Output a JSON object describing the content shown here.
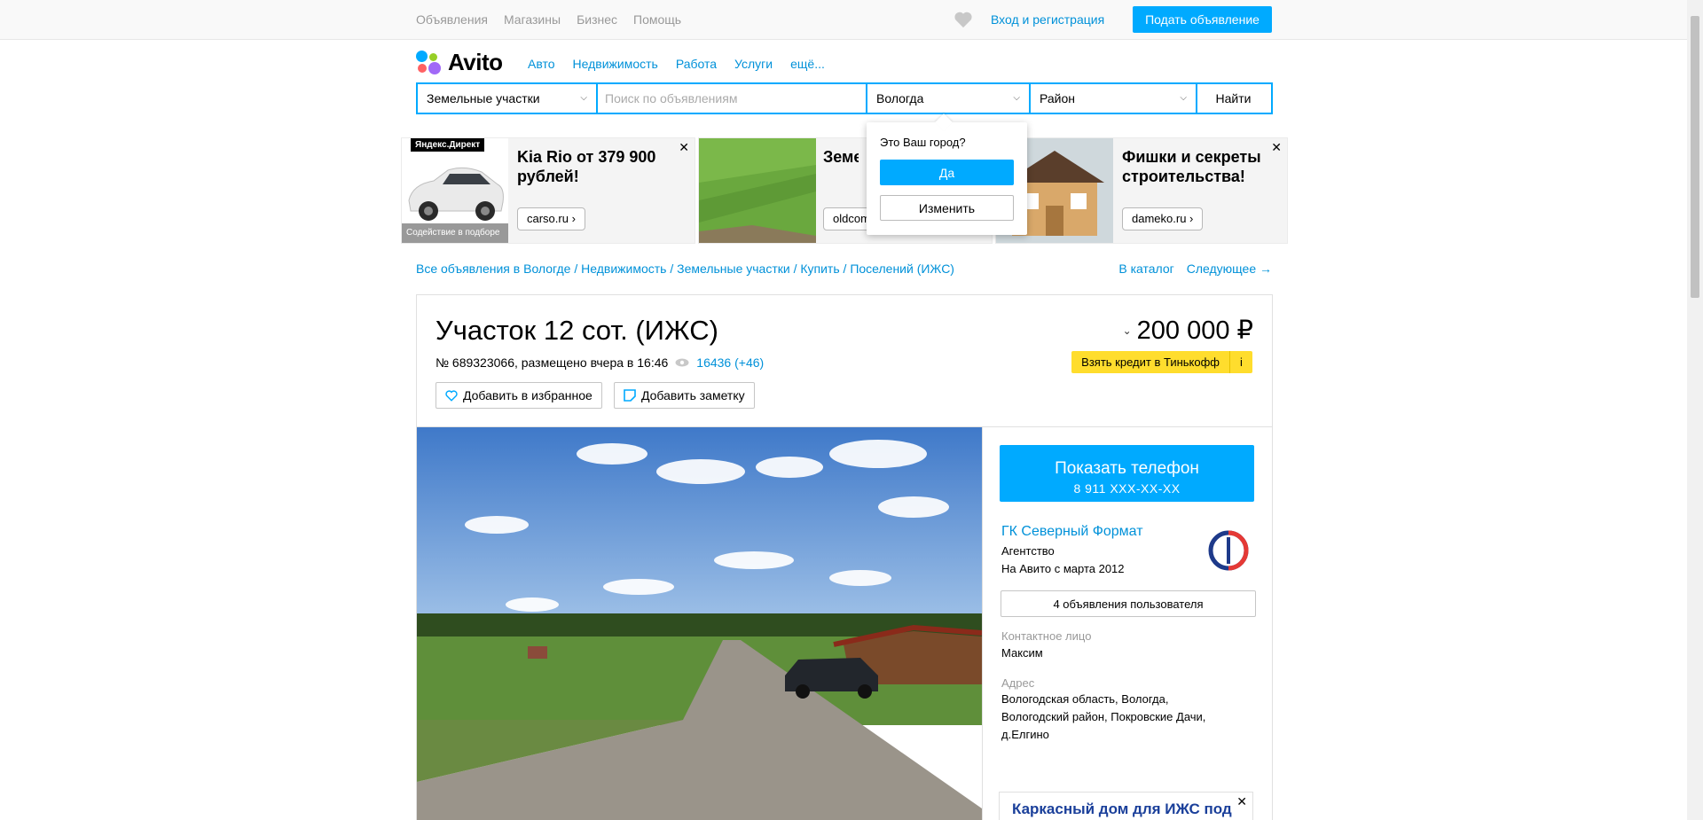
{
  "topbar": {
    "nav": [
      "Объявления",
      "Магазины",
      "Бизнес",
      "Помощь"
    ],
    "login": "Вход и регистрация",
    "post_button": "Подать объявление"
  },
  "logo": {
    "text": "Avito"
  },
  "mainnav": [
    "Авто",
    "Недвижимость",
    "Работа",
    "Услуги",
    "ещё..."
  ],
  "search": {
    "category": "Земельные участки",
    "placeholder": "Поиск по объявлениям",
    "city": "Вологда",
    "district": "Район",
    "find_button": "Найти"
  },
  "city_popup": {
    "question": "Это Ваш город?",
    "yes": "Да",
    "change": "Изменить"
  },
  "ads": [
    {
      "badge": "Яндекс.Директ",
      "title": "Kia Rio от 379 900 рублей!",
      "link": "carso.ru ›",
      "strip": "Содействие в подборе"
    },
    {
      "title": "Земельные участки",
      "link": "oldcom"
    },
    {
      "title": "Фишки и секреты строительства!",
      "link": "dameko.ru ›"
    }
  ],
  "breadcrumbs": [
    "Все объявления в Вологде",
    "Недвижимость",
    "Земельные участки",
    "Купить",
    "Поселений (ИЖС)"
  ],
  "catalog_links": {
    "catalog": "В каталог",
    "next": "Следующее →"
  },
  "listing": {
    "title": "Участок 12 сот. (ИЖС)",
    "meta": "№ 689323066, размещено вчера в 16:46",
    "views": "16436 (+46)",
    "favorite_button": "Добавить в избранное",
    "note_button": "Добавить заметку",
    "price": "200 000 ₽",
    "credit_button": "Взять кредит в Тинькофф",
    "credit_info": "i"
  },
  "seller": {
    "phone_button": "Показать телефон",
    "phone_masked": "8 911 XXX-XX-XX",
    "name": "ГК Северный Формат",
    "type": "Агентство",
    "since": "На Авито с марта 2012",
    "ads_button": "4 объявления пользователя",
    "contact_label": "Контактное лицо",
    "contact_name": "Максим",
    "address_label": "Адрес",
    "address_lines": [
      "Вологодская область, Вологда,",
      "Вологодский район, Покровские Дачи,",
      "д.Елгино"
    ]
  },
  "side_ad": {
    "title": "Каркасный дом для ИЖС под"
  },
  "colors": {
    "accent": "#00aaff",
    "link": "#0091d9",
    "credit": "#ffdd2d"
  }
}
